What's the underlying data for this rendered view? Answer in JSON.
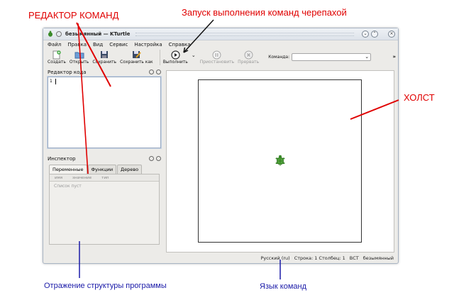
{
  "annotations": {
    "editor": "РЕДАКТОР КОМАНД",
    "run": "Запуск выполнения команд черепахой",
    "canvas": "ХОЛСТ",
    "structure": "Отражение структуры программы",
    "language": "Язык команд"
  },
  "window": {
    "title": "безымянный — KTurtle",
    "title_buttons": [
      "⌄",
      "⌃",
      "×"
    ]
  },
  "menu": [
    "Файл",
    "Правка",
    "Вид",
    "Сервис",
    "Настройка",
    "Справка"
  ],
  "toolbar": {
    "create": "Создать",
    "open": "Открыть",
    "save": "Сохранить",
    "save_as": "Сохранить как",
    "run": "Выполнить",
    "pause": "Приостановить",
    "abort": "Прервать",
    "command_label": "Команда:",
    "command_value": "",
    "more": "»"
  },
  "editor_panel": {
    "title": "Редактор кода",
    "line_number": "1"
  },
  "inspector": {
    "title": "Инспектор",
    "tabs": [
      "Переменные",
      "Функции",
      "Дерево"
    ],
    "columns": [
      "имя",
      "значение",
      "тип"
    ],
    "empty_text": "Список пуст"
  },
  "statusbar": {
    "language": "Русский (ru)",
    "position": "Строка: 1 Столбец: 1",
    "mode": "ВСТ",
    "file": "безымянный"
  },
  "colors": {
    "annotation_red": "#e00000",
    "annotation_blue": "#1a1aa8",
    "turtle_green": "#3a8a2a"
  }
}
